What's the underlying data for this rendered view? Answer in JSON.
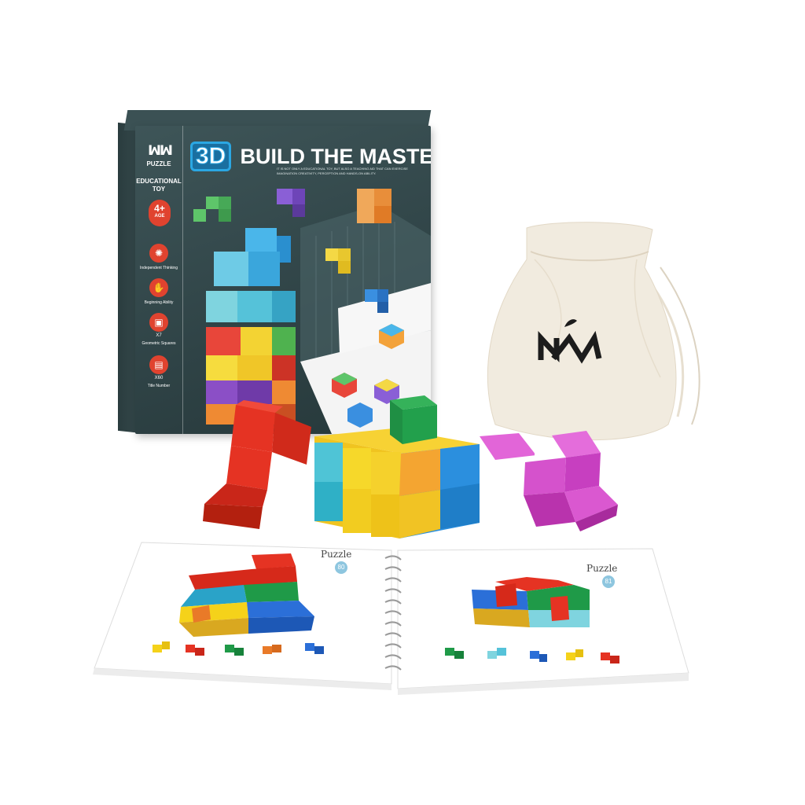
{
  "box": {
    "brand": "PUZZLE",
    "category": "EDUCATIONAL TOY",
    "age_value": "4+",
    "age_word": "AGE",
    "title_prefix": "3D",
    "title": "BUILD THE MASTER",
    "subtitle": "IT IS NOT ONLY A EDUCATIONAL TOY, BUT ALSO A TEACHING AID THAT CAN EXERCISE IMAGINATION CREATIVITY, PERCEPTION AND HANDS-ON ABILITY.",
    "features": [
      {
        "icon": "brain-icon",
        "label": "Independent Thinking"
      },
      {
        "icon": "hand-icon",
        "label": "Beginning Ability"
      },
      {
        "icon": "cube-icon",
        "label": "Geometric Squares",
        "badge": "X7"
      },
      {
        "icon": "cards-icon",
        "label": "Title Number",
        "badge": "X60"
      }
    ]
  },
  "book": {
    "left_page": {
      "label": "Puzzle",
      "number": "80"
    },
    "right_page": {
      "label": "Puzzle",
      "number": "81"
    }
  },
  "colors": {
    "box_teal": "#2f4346",
    "accent_red": "#e0432f",
    "cube_yellow": "#f5d21a",
    "cube_red": "#e53323",
    "cube_green": "#1f9a48",
    "cube_blue": "#2b8fde",
    "cube_magenta": "#d94fc8",
    "bag_canvas": "#f1ebdf"
  }
}
